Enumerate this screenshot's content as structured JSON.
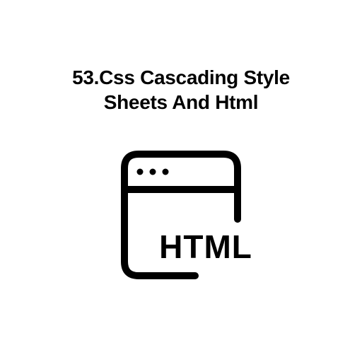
{
  "heading": {
    "line1": "53.Css Cascading Style",
    "line2": "Sheets And Html"
  },
  "icon": {
    "label": "HTML"
  }
}
